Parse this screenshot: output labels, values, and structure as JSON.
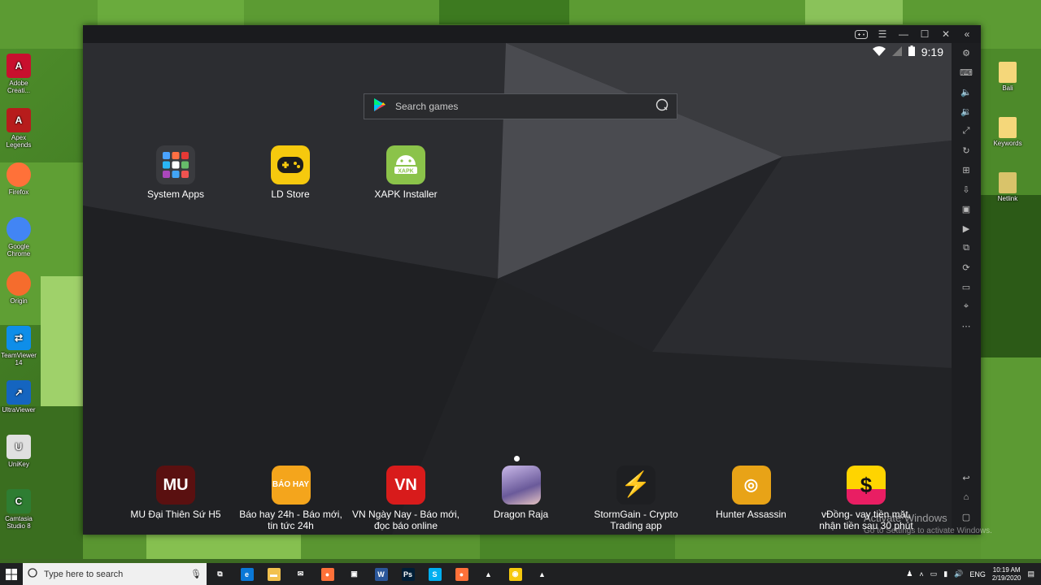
{
  "desktop": {
    "left_icons": [
      {
        "label": "Adobe Creati...",
        "glyph": "A",
        "color": "#c8102e"
      },
      {
        "label": "Apex Legends",
        "glyph": "A",
        "color": "#b71c1c"
      },
      {
        "label": "Firefox",
        "glyph": "",
        "color": "#ff7139"
      },
      {
        "label": "Google Chrome",
        "glyph": "",
        "color": "#4285f4"
      },
      {
        "label": "Origin",
        "glyph": "",
        "color": "#f56c2d"
      },
      {
        "label": "TeamViewer 14",
        "glyph": "⇄",
        "color": "#0e8ee9"
      },
      {
        "label": "UltraViewer",
        "glyph": "↗",
        "color": "#1565c0"
      },
      {
        "label": "UniKey",
        "glyph": "U",
        "color": "#e0e0e0"
      },
      {
        "label": "Camtasia Studio 8",
        "glyph": "C",
        "color": "#2e7d32"
      }
    ],
    "right_icons": [
      {
        "label": "Bali",
        "color": "#f5d77a"
      },
      {
        "label": "Keywords",
        "color": "#f5d77a"
      },
      {
        "label": "Netlink",
        "color": "#d9c36a"
      }
    ]
  },
  "emulator": {
    "status_time": "9:19",
    "search_placeholder": "Search games",
    "top_apps": [
      {
        "label": "System Apps",
        "icon": "folder-grid"
      },
      {
        "label": "LD Store",
        "icon": "gamepad"
      },
      {
        "label": "XAPK Installer",
        "icon": "android"
      }
    ],
    "dock_apps": [
      {
        "label": "MU Đại Thiên Sứ H5",
        "badge": "MU",
        "color": "#5a1010"
      },
      {
        "label": "Báo hay 24h - Báo mới, tin tức 24h",
        "badge": "BÁO HAY",
        "color": "#f4a51c"
      },
      {
        "label": "VN Ngày Nay - Báo mới, đọc báo online",
        "badge": "VN",
        "color": "#d81b1b"
      },
      {
        "label": "Dragon Raja",
        "badge": "",
        "color": "#8a7bb8"
      },
      {
        "label": "StormGain - Crypto Trading app",
        "badge": "⚡",
        "color": "#1e1f22"
      },
      {
        "label": "Hunter Assassin",
        "badge": "◎",
        "color": "#e8a317"
      },
      {
        "label": "vĐồng- vay tiền mặt, nhận tiền sau 30 phút",
        "badge": "$",
        "color": "#ffd400"
      }
    ]
  },
  "watermark": {
    "line1": "Activate Windows",
    "line2": "Go to Settings to activate Windows."
  },
  "taskbar": {
    "search_placeholder": "Type here to search",
    "apps": [
      {
        "name": "task-view",
        "glyph": "⧉",
        "color": "#1f2022"
      },
      {
        "name": "edge",
        "glyph": "e",
        "color": "#0a78d7"
      },
      {
        "name": "file-explorer",
        "glyph": "▬",
        "color": "#f2c14e"
      },
      {
        "name": "mail",
        "glyph": "✉",
        "color": "#1f2022"
      },
      {
        "name": "firefox",
        "glyph": "●",
        "color": "#ff7139"
      },
      {
        "name": "store",
        "glyph": "▣",
        "color": "#1f2022"
      },
      {
        "name": "word-doc",
        "glyph": "W",
        "color": "#2b579a"
      },
      {
        "name": "photoshop",
        "glyph": "Ps",
        "color": "#001e36"
      },
      {
        "name": "skype",
        "glyph": "S",
        "color": "#00aff0"
      },
      {
        "name": "firefox-2",
        "glyph": "●",
        "color": "#ff7139"
      },
      {
        "name": "apex",
        "glyph": "▲",
        "color": "#1f2022"
      },
      {
        "name": "ldplayer",
        "glyph": "◉",
        "color": "#f6c90e"
      },
      {
        "name": "emulator",
        "glyph": "▲",
        "color": "#1f2022"
      }
    ],
    "language": "ENG",
    "time": "10:19 AM",
    "date": "2/19/2020"
  }
}
